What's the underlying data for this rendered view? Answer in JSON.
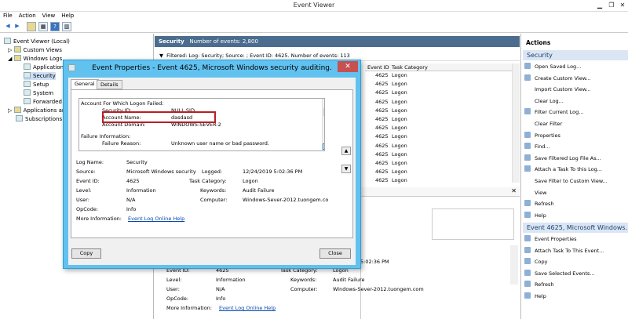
{
  "window": {
    "title": "Event Viewer",
    "min_icon": "minimize-icon",
    "max_icon": "restore-icon"
  },
  "menu": [
    "File",
    "Action",
    "View",
    "Help"
  ],
  "toolbar": {
    "icons": [
      "back-arrow-icon",
      "forward-arrow-icon",
      "folder-icon",
      "properties-icon",
      "help-icon",
      "panel-icon"
    ]
  },
  "tree": [
    {
      "label": "Event Viewer (Local)",
      "indent": 0
    },
    {
      "label": "Custom Views",
      "indent": 1
    },
    {
      "label": "Windows Logs",
      "indent": 1
    },
    {
      "label": "Application",
      "indent": 2
    },
    {
      "label": "Security",
      "indent": 2
    },
    {
      "label": "Setup",
      "indent": 2
    },
    {
      "label": "System",
      "indent": 2
    },
    {
      "label": "Forwarded E",
      "indent": 2
    },
    {
      "label": "Applications an",
      "indent": 1
    },
    {
      "label": "Subscriptions",
      "indent": 1
    }
  ],
  "center": {
    "header_title": "Security",
    "header_count": "Number of events: 2,800",
    "filter": "Filtered: Log: Security; Source: ; Event ID: 4625. Number of events: 113",
    "columns": [
      "Event ID",
      "Task Category"
    ],
    "rows": [
      {
        "id": "4625",
        "cat": "Logon"
      },
      {
        "id": "4625",
        "cat": "Logon"
      },
      {
        "id": "4625",
        "cat": "Logon"
      },
      {
        "id": "4625",
        "cat": "Logon"
      },
      {
        "id": "4625",
        "cat": "Logon"
      },
      {
        "id": "4625",
        "cat": "Logon"
      },
      {
        "id": "4625",
        "cat": "Logon"
      },
      {
        "id": "4625",
        "cat": "Logon"
      },
      {
        "id": "4625",
        "cat": "Logon"
      },
      {
        "id": "4625",
        "cat": "Logon"
      },
      {
        "id": "4625",
        "cat": "Logon"
      },
      {
        "id": "4625",
        "cat": "Logon"
      },
      {
        "id": "4625",
        "cat": "Logon"
      }
    ],
    "lower": {
      "time_fragment": "5:02:36 PM",
      "event_id_label": "Event ID:",
      "event_id": "4625",
      "task_label": "Task Category:",
      "task": "Logon",
      "level_label": "Level:",
      "level": "Information",
      "keywords_label": "Keywords:",
      "keywords": "Audit Failure",
      "user_label": "User:",
      "user": "N/A",
      "computer_label": "Computer:",
      "computer": "Windows-Sever-2012.tuongem.com",
      "opcode_label": "OpCode:",
      "opcode": "Info",
      "moreinfo_label": "More Information:",
      "moreinfo_link": "Event Log Online Help"
    }
  },
  "dialog": {
    "title": "Event Properties - Event 4625, Microsoft Windows security auditing.",
    "tabs": [
      "General",
      "Details"
    ],
    "description": {
      "header": "Account For Which Logon Failed:",
      "sid_label": "Security ID:",
      "sid": "NULL SID",
      "acct_label": "Account Name:",
      "acct": "dasdasd",
      "domain_label": "Account Domain:",
      "domain": "WINDOWS-SEVER-2",
      "fail_header": "Failure Information:",
      "reason_label": "Failure Reason:",
      "reason": "Unknown user name or bad password."
    },
    "fields": {
      "logname_label": "Log Name:",
      "logname": "Security",
      "source_label": "Source:",
      "source": "Microsoft Windows security",
      "logged_label": "Logged:",
      "logged": "12/24/2019 5:02:36 PM",
      "eventid_label": "Event ID:",
      "eventid": "4625",
      "task_label": "Task Category:",
      "task": "Logon",
      "level_label": "Level:",
      "level": "Information",
      "keywords_label": "Keywords:",
      "keywords": "Audit Failure",
      "user_label": "User:",
      "user": "N/A",
      "computer_label": "Computer:",
      "computer": "Windows-Sever-2012.tuongem.co",
      "opcode_label": "OpCode:",
      "opcode": "Info",
      "moreinfo_label": "More Information:",
      "moreinfo_link": "Event Log Online Help"
    },
    "copy_button": "Copy",
    "close_button": "Close"
  },
  "actions": {
    "header": "Actions",
    "section1": "Security",
    "items1": [
      "Open Saved Log...",
      "Create Custom View...",
      "Import Custom View...",
      "Clear Log...",
      "Filter Current Log...",
      "Clear Filter",
      "Properties",
      "Find...",
      "Save Filtered Log File As...",
      "Attach a Task To this Log...",
      "Save Filter to Custom View...",
      "View",
      "Refresh",
      "Help"
    ],
    "section2": "Event 4625, Microsoft Windows...",
    "items2": [
      "Event Properties",
      "Attach Task To This Event...",
      "Copy",
      "Save Selected Events...",
      "Refresh",
      "Help"
    ]
  },
  "colors": {
    "accent": "#4b6c8e",
    "dialog_frame": "#61c2f0",
    "highlight": "#b81e25",
    "close": "#c75050",
    "link": "#0645ad"
  }
}
